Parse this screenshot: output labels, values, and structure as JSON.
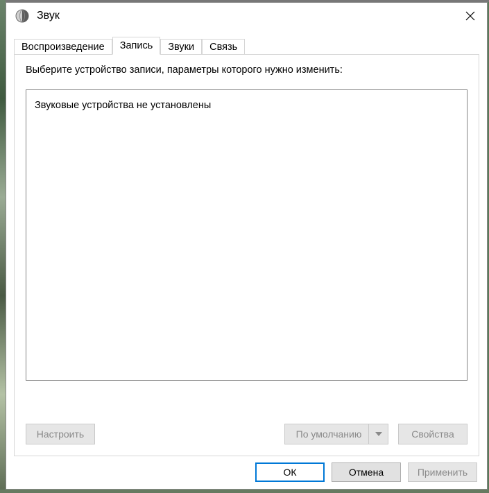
{
  "window": {
    "title": "Звук"
  },
  "tabs": [
    {
      "label": "Воспроизведение"
    },
    {
      "label": "Запись"
    },
    {
      "label": "Звуки"
    },
    {
      "label": "Связь"
    }
  ],
  "panel": {
    "instruction": "Выберите устройство записи, параметры которого нужно изменить:",
    "empty_message": "Звуковые устройства не установлены",
    "configure_label": "Настроить",
    "default_label": "По умолчанию",
    "properties_label": "Свойства"
  },
  "dialog_buttons": {
    "ok": "ОК",
    "cancel": "Отмена",
    "apply": "Применить"
  }
}
